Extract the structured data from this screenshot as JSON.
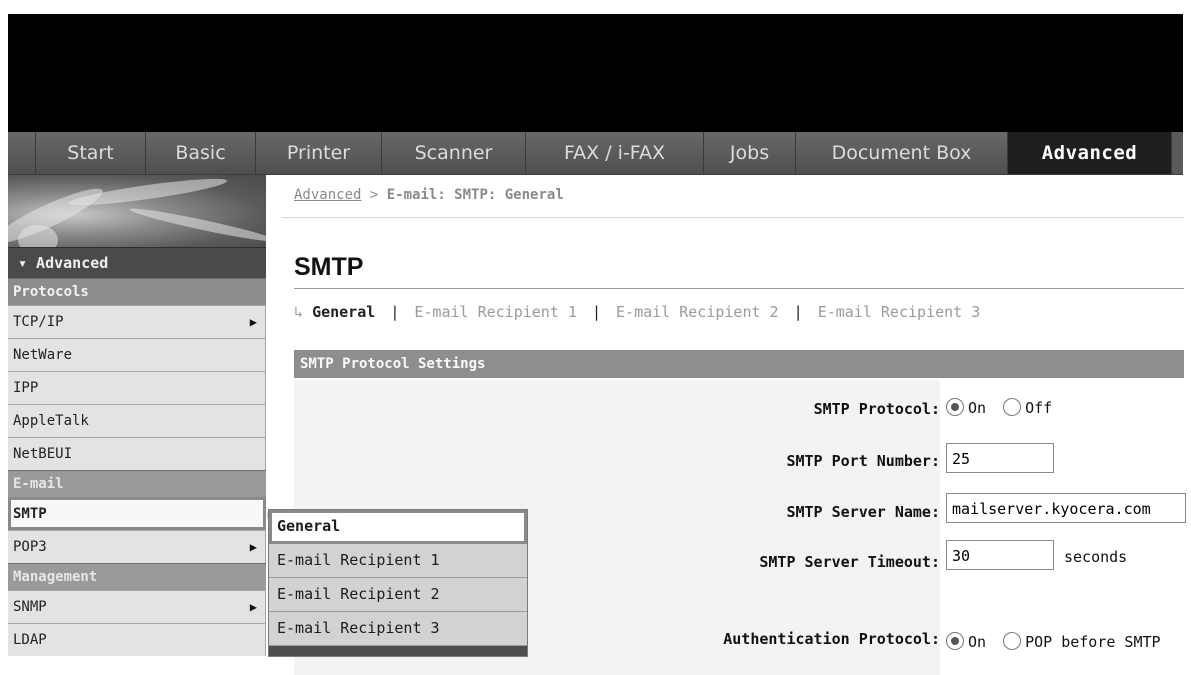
{
  "nav": {
    "tabs": [
      {
        "label": "Start"
      },
      {
        "label": "Basic"
      },
      {
        "label": "Printer"
      },
      {
        "label": "Scanner"
      },
      {
        "label": "FAX / i-FAX"
      },
      {
        "label": "Jobs"
      },
      {
        "label": "Document Box"
      },
      {
        "label": "Advanced",
        "active": true
      }
    ]
  },
  "sidebar": {
    "header": "▾ Advanced",
    "sections": [
      {
        "title": "Protocols",
        "items": [
          {
            "label": "TCP/IP",
            "arrow": "▶"
          },
          {
            "label": "NetWare"
          },
          {
            "label": "IPP"
          },
          {
            "label": "AppleTalk"
          },
          {
            "label": "NetBEUI"
          }
        ]
      },
      {
        "title": "E-mail",
        "items": [
          {
            "label": "SMTP",
            "arrow": "▶",
            "selected": true
          },
          {
            "label": "POP3",
            "arrow": "▶"
          }
        ]
      },
      {
        "title": "Management",
        "items": [
          {
            "label": "SNMP",
            "arrow": "▶"
          },
          {
            "label": "LDAP"
          }
        ]
      }
    ]
  },
  "flyout": {
    "items": [
      {
        "label": "General",
        "selected": true
      },
      {
        "label": "E-mail Recipient 1"
      },
      {
        "label": "E-mail Recipient 2"
      },
      {
        "label": "E-mail Recipient 3"
      }
    ]
  },
  "breadcrumb": {
    "link": "Advanced",
    "separator": ">",
    "current": "E-mail: SMTP: General"
  },
  "page": {
    "title": "SMTP",
    "subtabs": {
      "arrow": "↳",
      "current": "General",
      "separator": "|",
      "links": [
        "E-mail Recipient 1",
        "E-mail Recipient 2",
        "E-mail Recipient 3"
      ]
    },
    "section_title": "SMTP Protocol Settings"
  },
  "form": {
    "smtp_protocol": {
      "label": "SMTP Protocol:",
      "options": [
        "On",
        "Off"
      ],
      "selected": "On"
    },
    "port": {
      "label": "SMTP Port Number:",
      "value": "25"
    },
    "server_name": {
      "label": "SMTP Server Name:",
      "value": "mailserver.kyocera.com"
    },
    "timeout": {
      "label": "SMTP Server Timeout:",
      "value": "30",
      "unit": "seconds"
    },
    "auth_protocol": {
      "label": "Authentication Protocol:",
      "options": [
        "On",
        "POP before SMTP"
      ],
      "selected": "On"
    }
  },
  "colors": {
    "banner": "#000000",
    "nav_bg": "#5a5a5a",
    "nav_active": "#1e1e1e",
    "section_bar": "#8e8e8e",
    "form_bg": "#f3f3f3"
  }
}
